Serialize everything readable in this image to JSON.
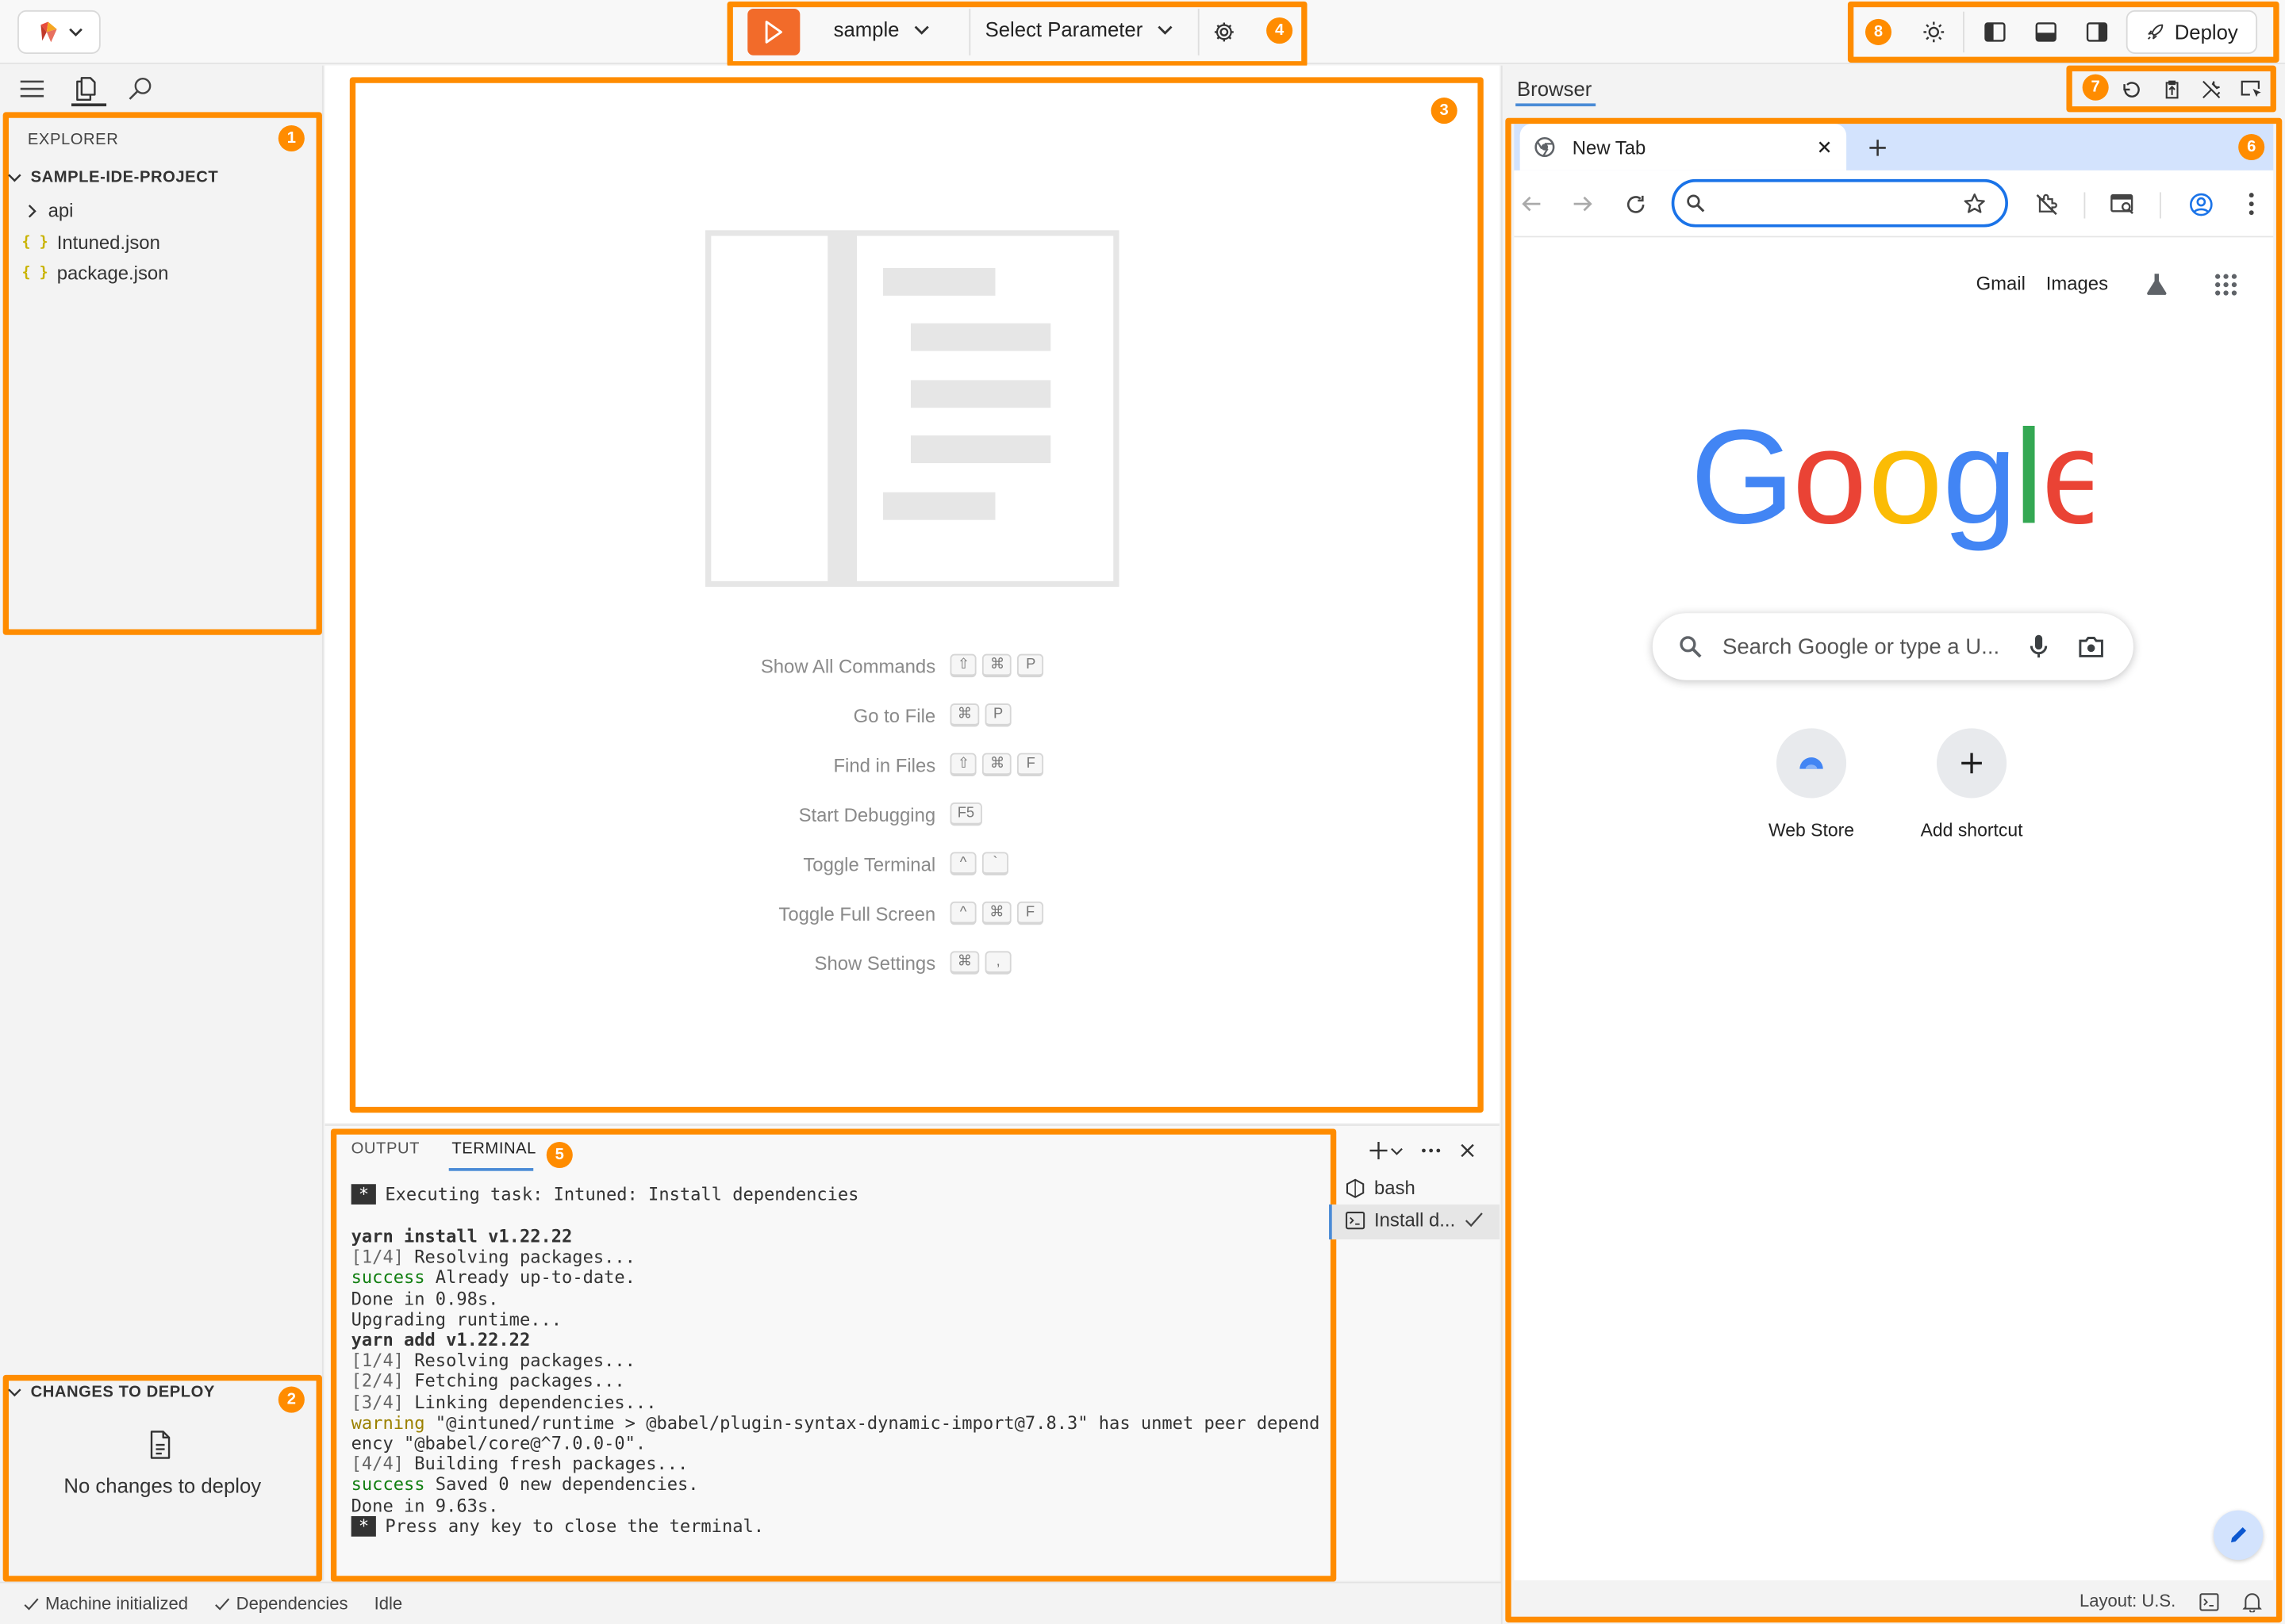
{
  "topbar": {
    "run_config": "sample",
    "parameter_select": "Select Parameter",
    "deploy_label": "Deploy"
  },
  "callouts": [
    "1",
    "2",
    "3",
    "4",
    "5",
    "6",
    "7",
    "8"
  ],
  "sidebar": {
    "explorer_title": "EXPLORER",
    "project_name": "SAMPLE-IDE-PROJECT",
    "items": [
      {
        "label": "api",
        "type": "folder"
      },
      {
        "label": "Intuned.json",
        "type": "json"
      },
      {
        "label": "package.json",
        "type": "json"
      }
    ],
    "changes_title": "CHANGES TO DEPLOY",
    "changes_empty": "No changes to deploy"
  },
  "editor": {
    "commands": [
      {
        "name": "Show All Commands",
        "keys": [
          "⇧",
          "⌘",
          "P"
        ]
      },
      {
        "name": "Go to File",
        "keys": [
          "⌘",
          "P"
        ]
      },
      {
        "name": "Find in Files",
        "keys": [
          "⇧",
          "⌘",
          "F"
        ]
      },
      {
        "name": "Start Debugging",
        "keys": [
          "F5"
        ]
      },
      {
        "name": "Toggle Terminal",
        "keys": [
          "^",
          "`"
        ]
      },
      {
        "name": "Toggle Full Screen",
        "keys": [
          "^",
          "⌘",
          "F"
        ]
      },
      {
        "name": "Show Settings",
        "keys": [
          "⌘",
          ","
        ]
      }
    ]
  },
  "panel": {
    "tabs": [
      "OUTPUT",
      "TERMINAL"
    ],
    "active_tab": "TERMINAL",
    "terminals": [
      {
        "label": "bash"
      },
      {
        "label": "Install d..."
      }
    ],
    "lines": {
      "exec": "Executing task: Intuned: Install dependencies",
      "l1": "yarn install v1.22.22",
      "l2a": "[1/4]",
      "l2b": " Resolving packages...",
      "l3a": "success",
      "l3b": " Already up-to-date.",
      "l4": "Done in 0.98s.",
      "l5": "Upgrading runtime...",
      "l6": "yarn add v1.22.22",
      "l7a": "[1/4]",
      "l7b": " Resolving packages...",
      "l8a": "[2/4]",
      "l8b": " Fetching packages...",
      "l9a": "[3/4]",
      "l9b": " Linking dependencies...",
      "l10a": "warning",
      "l10b": " \"@intuned/runtime > @babel/plugin-syntax-dynamic-import@7.8.3\" has unmet peer depend",
      "l11": "ency \"@babel/core@^7.0.0-0\".",
      "l12a": "[4/4]",
      "l12b": " Building fresh packages...",
      "l13a": "success",
      "l13b": " Saved 0 new dependencies.",
      "l14": "Done in 9.63s.",
      "l15": "Press any key to close the terminal."
    }
  },
  "status": {
    "machine": "Machine initialized",
    "deps": "Dependencies",
    "idle": "Idle"
  },
  "browser": {
    "pane_title": "Browser",
    "tab_title": "New Tab",
    "links": [
      "Gmail",
      "Images"
    ],
    "search_placeholder": "Search Google or type a U...",
    "shortcuts": [
      {
        "label": "Web Store"
      },
      {
        "label": "Add shortcut"
      }
    ],
    "layout_status": "Layout: U.S."
  },
  "colors": {
    "accent_orange": "#ff8c00",
    "run_button": "#f26b2a",
    "chrome_tabbar": "#d3e3fd",
    "google_blue": "#4285F4",
    "google_red": "#EA4335",
    "google_yellow": "#FBBC05",
    "google_green": "#34A853"
  }
}
